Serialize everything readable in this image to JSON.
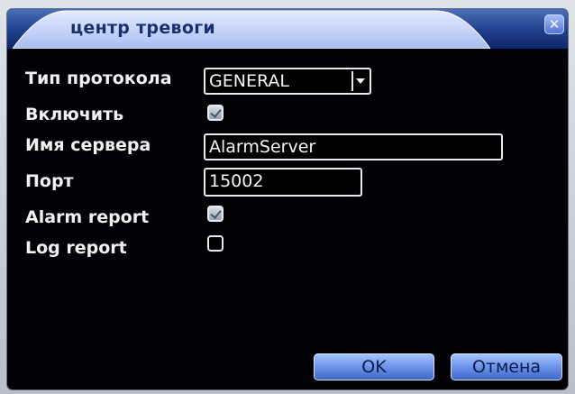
{
  "window": {
    "title": "центр тревоги",
    "close_icon": "close-icon"
  },
  "form": {
    "protocol_type": {
      "label": "Тип протокола",
      "value": "GENERAL"
    },
    "enable": {
      "label": "Включить",
      "checked": true
    },
    "server_name": {
      "label": "Имя сервера",
      "value": "AlarmServer"
    },
    "port": {
      "label": "Порт",
      "value": "15002"
    },
    "alarm_report": {
      "label": "Alarm report",
      "checked": true
    },
    "log_report": {
      "label": "Log report",
      "checked": false
    }
  },
  "buttons": {
    "ok": "OK",
    "cancel": "Отмена"
  },
  "colors": {
    "title_band": "#1f3f8c",
    "title_tab": "#c3d3ff",
    "background": "#020206",
    "button_accent": "#6a93ea"
  }
}
